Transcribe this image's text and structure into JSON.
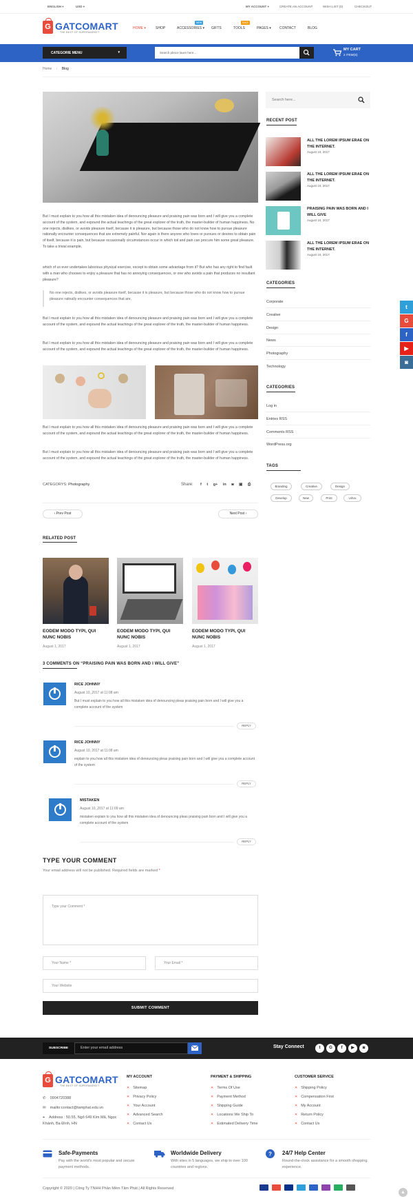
{
  "topbar": {
    "language": "ENGLISH",
    "currency": "USD",
    "my_account": "MY ACCOUNT",
    "create_account": "CREATE AN ACCOUNT",
    "wishlist": "WISH LIST (0)",
    "checkout": "CHECKOUT"
  },
  "brand": {
    "name": "GATCOMART",
    "tagline": "THE BEST OF SUPERMARKET",
    "primary_color": "#2e63c6",
    "accent_color": "#e74c3c"
  },
  "nav": {
    "items": [
      "HOME",
      "SHOP",
      "ACCESSORIES",
      "GIFTS",
      "TOOLS",
      "PAGES",
      "CONTACT",
      "BLOG"
    ],
    "badge_new": "NEW",
    "badge_sale": "SALE"
  },
  "bar": {
    "category_menu": "CATEGORIE MENU",
    "search_placeholder": "Search pbnce laure here...",
    "cart_title": "MY CART",
    "cart_items": "2 ITEM(S)"
  },
  "breadcrumb": {
    "home": "Home",
    "current": "Blog"
  },
  "post": {
    "p1": "But I must explain to you how all this mistaken idea of denouncing pleasure and praising pain was born and I will give you a complete account of the system, and expound the actual teachings of the great explorer of the truth, the master-builder of human happiness. No one rejects, dislikes, or avoids pleasure itself, because it is pleasure, but because those who do not know how to pursue pleasure rationally encounter consequences that are extremely painful. Nor again is there anyone who loves or pursues or desires to obtain pain of itself, because it is pain, but because occasionally circumstances occur in which toil and pain can procure him some great pleasure. To take a trivial example,",
    "p2": "which of us ever undertakes laborious physical exercise, except to obtain some advantage from it? But who has any right to find fault with a man who chooses to enjoy a pleasure that has no annoying consequences, or one who avoids a pain that produces no resultant pleasure?",
    "quote": "No one rejects, dislikes, or avoids pleasure itself, because it is pleasure, but because those who do not know how to pursue pleasure ratinally encounter consequences that are.",
    "p3": "But I must explain to you how all this mistaken idea of denouncing pleasure and praising pain was born and I will give you a complete account of the system, and expound the actual teachings of the great explorer of the truth, the master-builder of human happiness.",
    "p4": "But I must explain to you how all this mistaken idea of denouncing pleasure and praising pain was born and I will give you a complete account of the system, and expound the actual teachings of the great explorer of the truth, the master-builder of human happiness.",
    "p5": "But I must explain to you how all this mistaken idea of denouncing pleasure and praising pain was born and I will give you a complete account of the system, and expound the actual teachings of the great explorer of the truth, the master-builder of human happiness.",
    "p6": "But I must explain to you how all this mistaken idea of denouncing pleasure and praising pain was born and I will give you a complete account of the system, and expound the actual teachings of the great explorer of the truth, the master-builder of human happiness.",
    "category_label": "CATEGORYS:",
    "category_value": "Photography",
    "share_label": "Share:",
    "prev": "‹ Prev Post",
    "next": "Next Post ›"
  },
  "related": {
    "title": "RELATED POST",
    "items": [
      {
        "title": "EODEM MODO TYPI, QUI NUNC NOBIS",
        "date": "August 1, 2017"
      },
      {
        "title": "EODEM MODO TYPI, QUI NUNC NOBIS",
        "date": "August 1, 2017"
      },
      {
        "title": "EODEM MODO TYPI, QUI NUNC NOBIS",
        "date": "August 1, 2017"
      }
    ]
  },
  "comments": {
    "title": "3 COMMENTS ON “PRAISING PAIN WAS BORN AND I WILL GIVE”",
    "reply": "REPLY",
    "items": [
      {
        "name": "RICE JOHNNY",
        "date": "August 10, 2017 at 11:08 am",
        "body": "But I must explain to you how all this mistaken idea of denouncing pleas praising pain born and I will give you a complete account of the system"
      },
      {
        "name": "RICE JOHNNY",
        "date": "August 10, 2017 at 11:08 am",
        "body": "explain to you how all this mistaken idea of denouncing pleas praising pain born and I will give you a complete account of the system"
      },
      {
        "name": "MISTAKEN",
        "date": "August 10, 2017 at 11:09 am",
        "body": "mistaken explain to you how all this mistaken idea of denouncing pleas praising pain born and I will give you a complete account of the system"
      }
    ]
  },
  "form": {
    "title": "TYPE YOUR COMMENT",
    "note": "Your email address will not be published. Required fields are marked",
    "required": "*",
    "comment_ph": "Type your Comment *",
    "name_ph": "Your Name *",
    "email_ph": "Your Email *",
    "website_ph": "Your Website",
    "submit": "SUBMIT COMMENT"
  },
  "sidebar": {
    "search_ph": "Search here...",
    "recent_title": "RECENT POST",
    "recent": [
      {
        "title": "ALL THE LOREM IPSUM ERAE ON THE INTERNET.",
        "date": "August 10, 2017"
      },
      {
        "title": "ALL THE LOREM IPSUM ERAE ON THE INTERNET.",
        "date": "August 10, 2017"
      },
      {
        "title": "PRAISING PAIN WAS BORN AND I WILL GIVE",
        "date": "August 10, 2017"
      },
      {
        "title": "ALL THE LOREM IPSUM ERAE ON THE INTERNET.",
        "date": "August 10, 2017"
      }
    ],
    "cat_title": "CATEGORIES",
    "categories": [
      "Corporate",
      "Creative",
      "Design",
      "News",
      "Photography",
      "Technology"
    ],
    "cat2_title": "CATEGORIES",
    "meta": [
      "Log in",
      "Entries RSS",
      "Comments RSS",
      "WordPress.org"
    ],
    "tags_title": "TAGS",
    "tags": [
      "Branding",
      "Creative",
      "Design",
      "Develop",
      "New",
      "Print",
      "Ui/Ux"
    ]
  },
  "footer": {
    "subscribe": "SUBSCRIBE",
    "email_ph": "Enter your email address",
    "stay": "Stay Connect",
    "address": {
      "phone": "0904720388",
      "email": "mailto:contact@tamphat.edu.vn",
      "addr": "Address : 50.55, Ngõ 649 Kim Mã, Ngọc Khánh, Ba Đình, HN"
    },
    "col1": {
      "title": "MY ACCOUNT",
      "items": [
        "Sitemap",
        "Privacy Policy",
        "Your Account",
        "Advanced Search",
        "Contact Us"
      ]
    },
    "col2": {
      "title": "PAYMENT & SHIPPING",
      "items": [
        "Terms Of Use",
        "Payment Method",
        "Shipping Guide",
        "Locations We Ship To",
        "Estimated Delivery Time"
      ]
    },
    "col3": {
      "title": "CUSTOMER SERVICE",
      "items": [
        "Shipping Policy",
        "Compensation First",
        "My Account",
        "Return Policy",
        "Contact Us"
      ]
    },
    "features": [
      {
        "title": "Safe-Payments",
        "desc": "Pay with the world's most popular and secure payment methods."
      },
      {
        "title": "Worldwide Delivery",
        "desc": "With sites in 5 languages, we ship to over 100 countries and regions."
      },
      {
        "title": "24/7 Help Center",
        "desc": "Round-the-clock assistance for a smooth shopping experience."
      }
    ],
    "copyright": "Copyright © 2020 | Công Ty TNHH Phần Mềm Tâm Phát | All Rights Reserved"
  }
}
